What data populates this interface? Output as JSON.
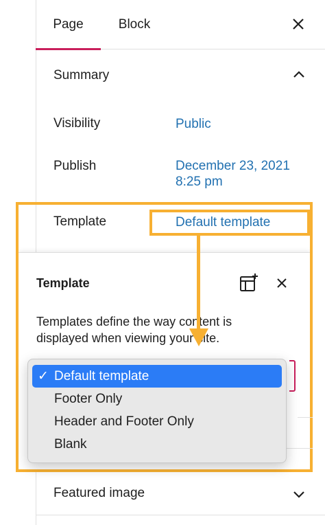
{
  "tabs": [
    {
      "label": "Page",
      "active": true
    },
    {
      "label": "Block",
      "active": false
    }
  ],
  "summary": {
    "title": "Summary",
    "rows": [
      {
        "label": "Visibility",
        "value": "Public"
      },
      {
        "label": "Publish",
        "value_line1": "December 23, 2021",
        "value_line2": "8:25 pm"
      },
      {
        "label": "Template",
        "value": "Default template"
      }
    ]
  },
  "popover": {
    "title": "Template",
    "description_line1": "Templates define the way content is",
    "description_line2": "displayed when viewing your site."
  },
  "dropdown": {
    "check": "✓",
    "options": [
      "Default template",
      "Footer Only",
      "Header and Footer Only",
      "Blank"
    ],
    "selected_index": 0
  },
  "featured": {
    "title": "Featured image"
  },
  "colors": {
    "accent": "#c91e5b",
    "link": "#2271b1",
    "highlight": "#f7b032",
    "selection": "#2b7cf6"
  },
  "icons": [
    "close-icon",
    "chevron-up-icon",
    "add-template-icon",
    "chevron-down-icon",
    "checkmark-icon"
  ]
}
